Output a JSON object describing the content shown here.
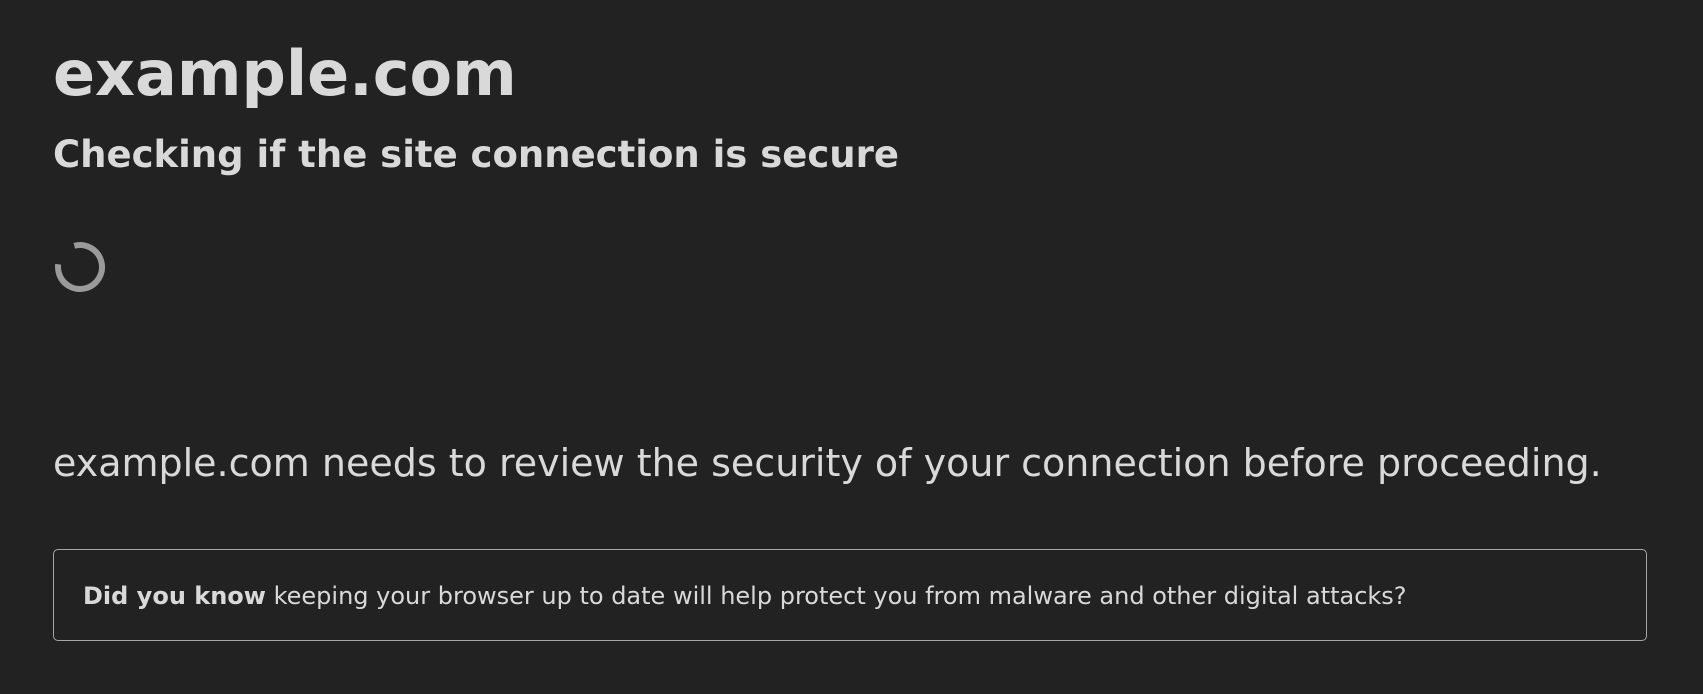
{
  "page": {
    "site_title": "example.com",
    "subtitle": "Checking if the site connection is secure",
    "message": "example.com needs to review the security of your connection before proceeding.",
    "tip": {
      "bold": "Did you know",
      "text": " keeping your browser up to date will help protect you from malware and other digital attacks?"
    }
  },
  "icons": {
    "spinner": "loading-spinner-icon"
  },
  "colors": {
    "background": "#222222",
    "text": "#d9d9d9",
    "border": "#a6a6a6",
    "spinner": "#9a9a9a"
  }
}
